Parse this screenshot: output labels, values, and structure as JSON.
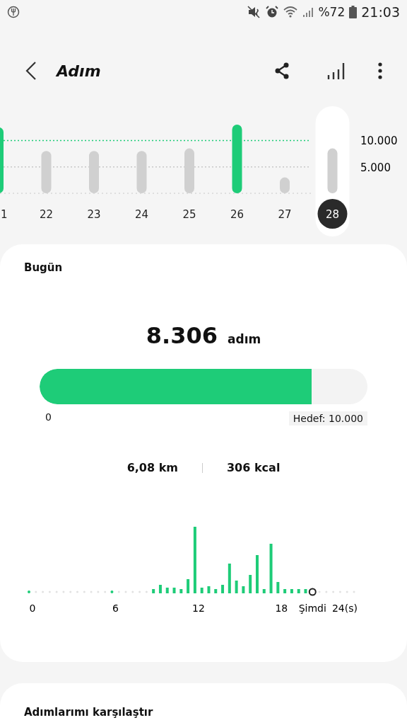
{
  "status_bar": {
    "battery": "%72",
    "time": "21:03"
  },
  "header": {
    "title": "Adım"
  },
  "daily_chart": {
    "chart_data": {
      "type": "bar",
      "categories": [
        "1",
        "22",
        "23",
        "24",
        "25",
        "26",
        "27",
        "28"
      ],
      "yticks": [
        {
          "value": 5000,
          "label": "5.000"
        },
        {
          "value": 10000,
          "label": "10.000"
        }
      ],
      "ylim": [
        0,
        13000
      ],
      "ref_lines": [
        {
          "axis": "y",
          "value": 5000,
          "color": "#c8c8c8"
        },
        {
          "axis": "y",
          "value": 10000,
          "color": "#1ecc78"
        }
      ],
      "series": [
        {
          "color": "#1ecc78",
          "values": [
            12500,
            null,
            null,
            null,
            null,
            13000,
            null,
            null
          ]
        },
        {
          "color": "#d0d0d0",
          "values": [
            null,
            8000,
            8000,
            8000,
            8500,
            null,
            3000,
            8500
          ]
        }
      ]
    },
    "days": [
      {
        "selected": false
      },
      {
        "selected": false
      },
      {
        "selected": false
      },
      {
        "selected": false
      },
      {
        "selected": false
      },
      {
        "selected": false
      },
      {
        "selected": false
      },
      {
        "selected": true
      }
    ]
  },
  "today": {
    "title": "Bugün",
    "steps": "8.306",
    "unit": "adım",
    "level": 0.8306,
    "min_label": "0",
    "goal_label": "Hedef: 10.000",
    "distance": "6,08 km",
    "calories": "306 kcal",
    "hour_labels": [
      "0",
      "6",
      "12",
      "18",
      "Şimdi",
      "24(s)"
    ]
  },
  "compare": {
    "title": "Adımlarımı karşılaştır"
  }
}
